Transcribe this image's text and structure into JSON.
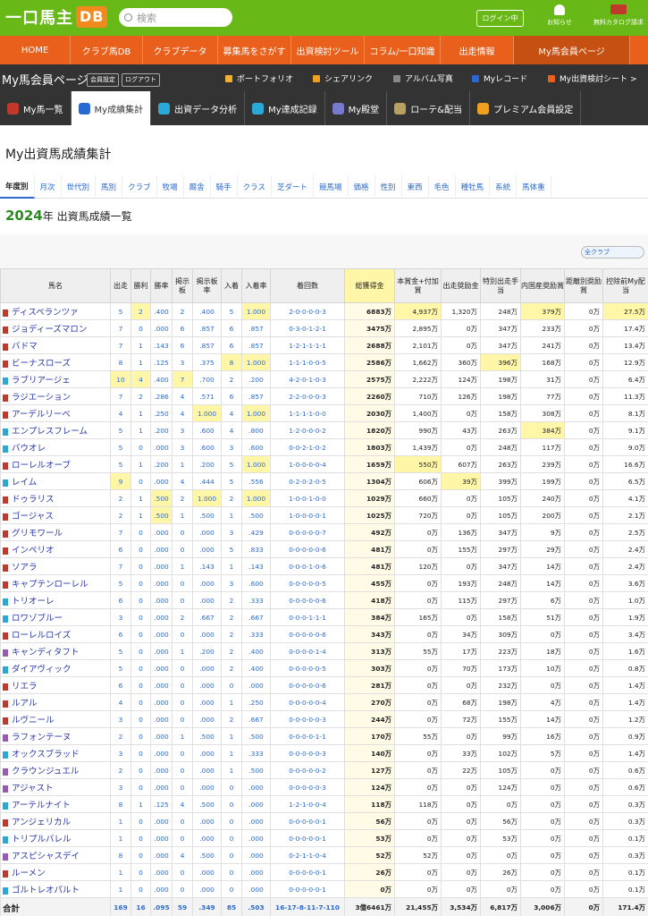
{
  "header": {
    "logo_text": "一口馬主",
    "logo_badge": "DB",
    "search_placeholder": "検索",
    "login_label": "ログイン中",
    "notice_label": "お知らせ",
    "catalog_label": "無料カタログ請求"
  },
  "gnav": [
    {
      "label": "HOME"
    },
    {
      "label": "クラブ馬DB"
    },
    {
      "label": "クラブデータ"
    },
    {
      "label": "募集馬をさがす"
    },
    {
      "label": "出資検討ツール"
    },
    {
      "label": "コラム/一口知識"
    },
    {
      "label": "出走情報"
    },
    {
      "label": "My馬会員ページ"
    }
  ],
  "mybar": {
    "title": "My馬会員ページ",
    "settings": "会員設定",
    "logout": "ログアウト",
    "links": [
      {
        "label": "ポートフォリオ",
        "color": "#f0b030"
      },
      {
        "label": "シェアリンク",
        "color": "#f0a020"
      },
      {
        "label": "アルバム写真",
        "color": "#888888"
      },
      {
        "label": "Myレコード",
        "color": "#2a6ad0"
      },
      {
        "label": "My出資検討シート >",
        "color": "#e8601c"
      }
    ]
  },
  "mytabs": [
    {
      "label": "My馬一覧",
      "color": "#c0392b"
    },
    {
      "label": "My成績集計",
      "color": "#2a6ad0"
    },
    {
      "label": "出資データ分析",
      "color": "#2aa8d8"
    },
    {
      "label": "My達成記録",
      "color": "#2aa8d8"
    },
    {
      "label": "My殿堂",
      "color": "#7a7acc"
    },
    {
      "label": "ローテ&配当",
      "color": "#b8a060"
    },
    {
      "label": "プレミアム会員設定",
      "color": "#f0a020"
    }
  ],
  "page_title": "My出資馬成績集計",
  "subtabs": [
    "年度別",
    "月次",
    "世代別",
    "馬別",
    "クラブ",
    "牧場",
    "厩舎",
    "騎手",
    "クラス",
    "芝ダート",
    "競馬場",
    "価格",
    "性別",
    "東西",
    "毛色",
    "種牡馬",
    "系統",
    "馬体重"
  ],
  "section": {
    "year": "2024",
    "title": "年 出資馬成績一覧"
  },
  "club_select": "全クラブ",
  "table_headers": [
    "馬名",
    "出走",
    "勝利",
    "勝率",
    "掲示板",
    "掲示板率",
    "入着",
    "入着率",
    "着回数",
    "総獲得金",
    "本賞金+付加賞",
    "出走奨励金",
    "特別出走手当",
    "内国産奨励賞",
    "距離別奨励賞",
    "控除前My配当"
  ],
  "rows": [
    {
      "name": "ディスペランツァ",
      "c": "#c0392b",
      "v": [
        "5",
        "2",
        ".400",
        "2",
        ".400",
        "5",
        "1.000",
        "2-0-0-0-0-3",
        "6883万",
        "4,937万",
        "1,320万",
        "248万",
        "379万",
        "0万",
        "27.5万"
      ]
    },
    {
      "name": "ジョディーズマロン",
      "c": "#c0392b",
      "v": [
        "7",
        "0",
        ".000",
        "6",
        ".857",
        "6",
        ".857",
        "0-3-0-1-2-1",
        "3475万",
        "2,895万",
        "0万",
        "347万",
        "233万",
        "0万",
        "17.4万"
      ]
    },
    {
      "name": "バドマ",
      "c": "#c0392b",
      "v": [
        "7",
        "1",
        ".143",
        "6",
        ".857",
        "6",
        ".857",
        "1-2-1-1-1-1",
        "2688万",
        "2,101万",
        "0万",
        "347万",
        "241万",
        "0万",
        "13.4万"
      ]
    },
    {
      "name": "ビーナスローズ",
      "c": "#c0392b",
      "v": [
        "8",
        "1",
        ".125",
        "3",
        ".375",
        "8",
        "1.000",
        "1-1-1-0-0-5",
        "2586万",
        "1,662万",
        "360万",
        "396万",
        "168万",
        "0万",
        "12.9万"
      ]
    },
    {
      "name": "ラブリアージェ",
      "c": "#2aa8d8",
      "v": [
        "10",
        "4",
        ".400",
        "7",
        ".700",
        "2",
        ".200",
        "4-2-0-1-0-3",
        "2575万",
        "2,222万",
        "124万",
        "198万",
        "31万",
        "0万",
        "6.4万"
      ]
    },
    {
      "name": "ラジエーション",
      "c": "#c0392b",
      "v": [
        "7",
        "2",
        ".286",
        "4",
        ".571",
        "6",
        ".857",
        "2-2-0-0-0-3",
        "2260万",
        "710万",
        "126万",
        "198万",
        "77万",
        "0万",
        "11.3万"
      ]
    },
    {
      "name": "アーデルリーベ",
      "c": "#c0392b",
      "v": [
        "4",
        "1",
        ".250",
        "4",
        "1.000",
        "4",
        "1.000",
        "1-1-1-1-0-0",
        "2030万",
        "1,400万",
        "0万",
        "158万",
        "308万",
        "0万",
        "8.1万"
      ]
    },
    {
      "name": "エンプレスフレーム",
      "c": "#2aa8d8",
      "v": [
        "5",
        "1",
        ".200",
        "3",
        ".600",
        "4",
        ".800",
        "1-2-0-0-0-2",
        "1820万",
        "990万",
        "43万",
        "263万",
        "384万",
        "0万",
        "9.1万"
      ]
    },
    {
      "name": "バウオレ",
      "c": "#2aa8d8",
      "v": [
        "5",
        "0",
        ".000",
        "3",
        ".600",
        "3",
        ".600",
        "0-0-2-1-0-2",
        "1803万",
        "1,439万",
        "0万",
        "248万",
        "117万",
        "0万",
        "9.0万"
      ]
    },
    {
      "name": "ローレルオーブ",
      "c": "#c0392b",
      "v": [
        "5",
        "1",
        ".200",
        "1",
        ".200",
        "5",
        "1.000",
        "1-0-0-0-0-4",
        "1659万",
        "550万",
        "607万",
        "263万",
        "239万",
        "0万",
        "16.6万"
      ]
    },
    {
      "name": "レイム",
      "c": "#2aa8d8",
      "v": [
        "9",
        "0",
        ".000",
        "4",
        ".444",
        "5",
        ".556",
        "0-2-0-2-0-5",
        "1304万",
        "606万",
        "39万",
        "399万",
        "199万",
        "0万",
        "6.5万"
      ]
    },
    {
      "name": "ドゥラリス",
      "c": "#c0392b",
      "v": [
        "2",
        "1",
        ".500",
        "2",
        "1.000",
        "2",
        "1.000",
        "1-0-0-1-0-0",
        "1029万",
        "660万",
        "0万",
        "105万",
        "240万",
        "0万",
        "4.1万"
      ]
    },
    {
      "name": "ゴージャス",
      "c": "#c0392b",
      "v": [
        "2",
        "1",
        ".500",
        "1",
        ".500",
        "1",
        ".500",
        "1-0-0-0-0-1",
        "1025万",
        "720万",
        "0万",
        "105万",
        "200万",
        "0万",
        "2.1万"
      ]
    },
    {
      "name": "グリモワール",
      "c": "#c0392b",
      "v": [
        "7",
        "0",
        ".000",
        "0",
        ".000",
        "3",
        ".429",
        "0-0-0-0-0-7",
        "492万",
        "0万",
        "136万",
        "347万",
        "9万",
        "0万",
        "2.5万"
      ]
    },
    {
      "name": "インペリオ",
      "c": "#c0392b",
      "v": [
        "6",
        "0",
        ".000",
        "0",
        ".000",
        "5",
        ".833",
        "0-0-0-0-0-6",
        "481万",
        "0万",
        "155万",
        "297万",
        "29万",
        "0万",
        "2.4万"
      ]
    },
    {
      "name": "ソアラ",
      "c": "#c0392b",
      "v": [
        "7",
        "0",
        ".000",
        "1",
        ".143",
        "1",
        ".143",
        "0-0-0-1-0-6",
        "481万",
        "120万",
        "0万",
        "347万",
        "14万",
        "0万",
        "2.4万"
      ]
    },
    {
      "name": "キャプテンローレル",
      "c": "#c0392b",
      "v": [
        "5",
        "0",
        ".000",
        "0",
        ".000",
        "3",
        ".600",
        "0-0-0-0-0-5",
        "455万",
        "0万",
        "193万",
        "248万",
        "14万",
        "0万",
        "3.6万"
      ]
    },
    {
      "name": "トリオーレ",
      "c": "#2aa8d8",
      "v": [
        "6",
        "0",
        ".000",
        "0",
        ".000",
        "2",
        ".333",
        "0-0-0-0-0-6",
        "418万",
        "0万",
        "115万",
        "297万",
        "6万",
        "0万",
        "1.0万"
      ]
    },
    {
      "name": "ロワゾブルー",
      "c": "#2aa8d8",
      "v": [
        "3",
        "0",
        ".000",
        "2",
        ".667",
        "2",
        ".667",
        "0-0-0-1-1-1",
        "384万",
        "165万",
        "0万",
        "158万",
        "51万",
        "0万",
        "1.9万"
      ]
    },
    {
      "name": "ローレルロイズ",
      "c": "#c0392b",
      "v": [
        "6",
        "0",
        ".000",
        "0",
        ".000",
        "2",
        ".333",
        "0-0-0-0-0-6",
        "343万",
        "0万",
        "34万",
        "309万",
        "0万",
        "0万",
        "3.4万"
      ]
    },
    {
      "name": "キャンディタフト",
      "c": "#9b59b6",
      "v": [
        "5",
        "0",
        ".000",
        "1",
        ".200",
        "2",
        ".400",
        "0-0-0-0-1-4",
        "313万",
        "55万",
        "17万",
        "223万",
        "18万",
        "0万",
        "1.6万"
      ]
    },
    {
      "name": "ダイアヴィック",
      "c": "#2aa8d8",
      "v": [
        "5",
        "0",
        ".000",
        "0",
        ".000",
        "2",
        ".400",
        "0-0-0-0-0-5",
        "303万",
        "0万",
        "70万",
        "173万",
        "10万",
        "0万",
        "0.8万"
      ]
    },
    {
      "name": "リエラ",
      "c": "#c0392b",
      "v": [
        "6",
        "0",
        ".000",
        "0",
        ".000",
        "0",
        ".000",
        "0-0-0-0-0-6",
        "281万",
        "0万",
        "0万",
        "232万",
        "0万",
        "0万",
        "1.4万"
      ]
    },
    {
      "name": "ルアル",
      "c": "#c0392b",
      "v": [
        "4",
        "0",
        ".000",
        "0",
        ".000",
        "1",
        ".250",
        "0-0-0-0-0-4",
        "270万",
        "0万",
        "68万",
        "198万",
        "4万",
        "0万",
        "1.4万"
      ]
    },
    {
      "name": "ルヴニール",
      "c": "#c0392b",
      "v": [
        "3",
        "0",
        ".000",
        "0",
        ".000",
        "2",
        ".667",
        "0-0-0-0-0-3",
        "244万",
        "0万",
        "72万",
        "155万",
        "14万",
        "0万",
        "1.2万"
      ]
    },
    {
      "name": "ラフォンテーヌ",
      "c": "#9b59b6",
      "v": [
        "2",
        "0",
        ".000",
        "1",
        ".500",
        "1",
        ".500",
        "0-0-0-0-1-1",
        "170万",
        "55万",
        "0万",
        "99万",
        "16万",
        "0万",
        "0.9万"
      ]
    },
    {
      "name": "オックスブラッド",
      "c": "#2aa8d8",
      "v": [
        "3",
        "0",
        ".000",
        "0",
        ".000",
        "1",
        ".333",
        "0-0-0-0-0-3",
        "140万",
        "0万",
        "33万",
        "102万",
        "5万",
        "0万",
        "1.4万"
      ]
    },
    {
      "name": "クラウンジュエル",
      "c": "#9b59b6",
      "v": [
        "2",
        "0",
        ".000",
        "0",
        ".000",
        "1",
        ".500",
        "0-0-0-0-0-2",
        "127万",
        "0万",
        "22万",
        "105万",
        "0万",
        "0万",
        "0.6万"
      ]
    },
    {
      "name": "アジャスト",
      "c": "#9b59b6",
      "v": [
        "3",
        "0",
        ".000",
        "0",
        ".000",
        "0",
        ".000",
        "0-0-0-0-0-3",
        "124万",
        "0万",
        "0万",
        "124万",
        "0万",
        "0万",
        "0.6万"
      ]
    },
    {
      "name": "アーテルナイト",
      "c": "#2aa8d8",
      "v": [
        "8",
        "1",
        ".125",
        "4",
        ".500",
        "0",
        ".000",
        "1-2-1-0-0-4",
        "118万",
        "118万",
        "0万",
        "0万",
        "0万",
        "0万",
        "0.3万"
      ]
    },
    {
      "name": "アンジェリカル",
      "c": "#c0392b",
      "v": [
        "1",
        "0",
        ".000",
        "0",
        ".000",
        "0",
        ".000",
        "0-0-0-0-0-1",
        "56万",
        "0万",
        "0万",
        "56万",
        "0万",
        "0万",
        "0.3万"
      ]
    },
    {
      "name": "トリプルバレル",
      "c": "#2aa8d8",
      "v": [
        "1",
        "0",
        ".000",
        "0",
        ".000",
        "0",
        ".000",
        "0-0-0-0-0-1",
        "53万",
        "0万",
        "0万",
        "53万",
        "0万",
        "0万",
        "0.1万"
      ]
    },
    {
      "name": "アスピシャスデイ",
      "c": "#9b59b6",
      "v": [
        "8",
        "0",
        ".000",
        "4",
        ".500",
        "0",
        ".000",
        "0-2-1-1-0-4",
        "52万",
        "52万",
        "0万",
        "0万",
        "0万",
        "0万",
        "0.3万"
      ]
    },
    {
      "name": "ルーメン",
      "c": "#c0392b",
      "v": [
        "1",
        "0",
        ".000",
        "0",
        ".000",
        "0",
        ".000",
        "0-0-0-0-0-1",
        "26万",
        "0万",
        "0万",
        "26万",
        "0万",
        "0万",
        "0.1万"
      ]
    },
    {
      "name": "ゴルトレオパルト",
      "c": "#2aa8d8",
      "v": [
        "1",
        "0",
        ".000",
        "0",
        ".000",
        "0",
        ".000",
        "0-0-0-0-0-1",
        "0万",
        "0万",
        "0万",
        "0万",
        "0万",
        "0万",
        "0.1万"
      ]
    }
  ],
  "total": {
    "label": "合計",
    "v": [
      "169",
      "16",
      ".095",
      "59",
      ".349",
      "85",
      ".503",
      "16-17-8-11-7-110",
      "3億6461万",
      "21,455万",
      "3,534万",
      "6,817万",
      "3,006万",
      "0万",
      "171.4万"
    ]
  }
}
